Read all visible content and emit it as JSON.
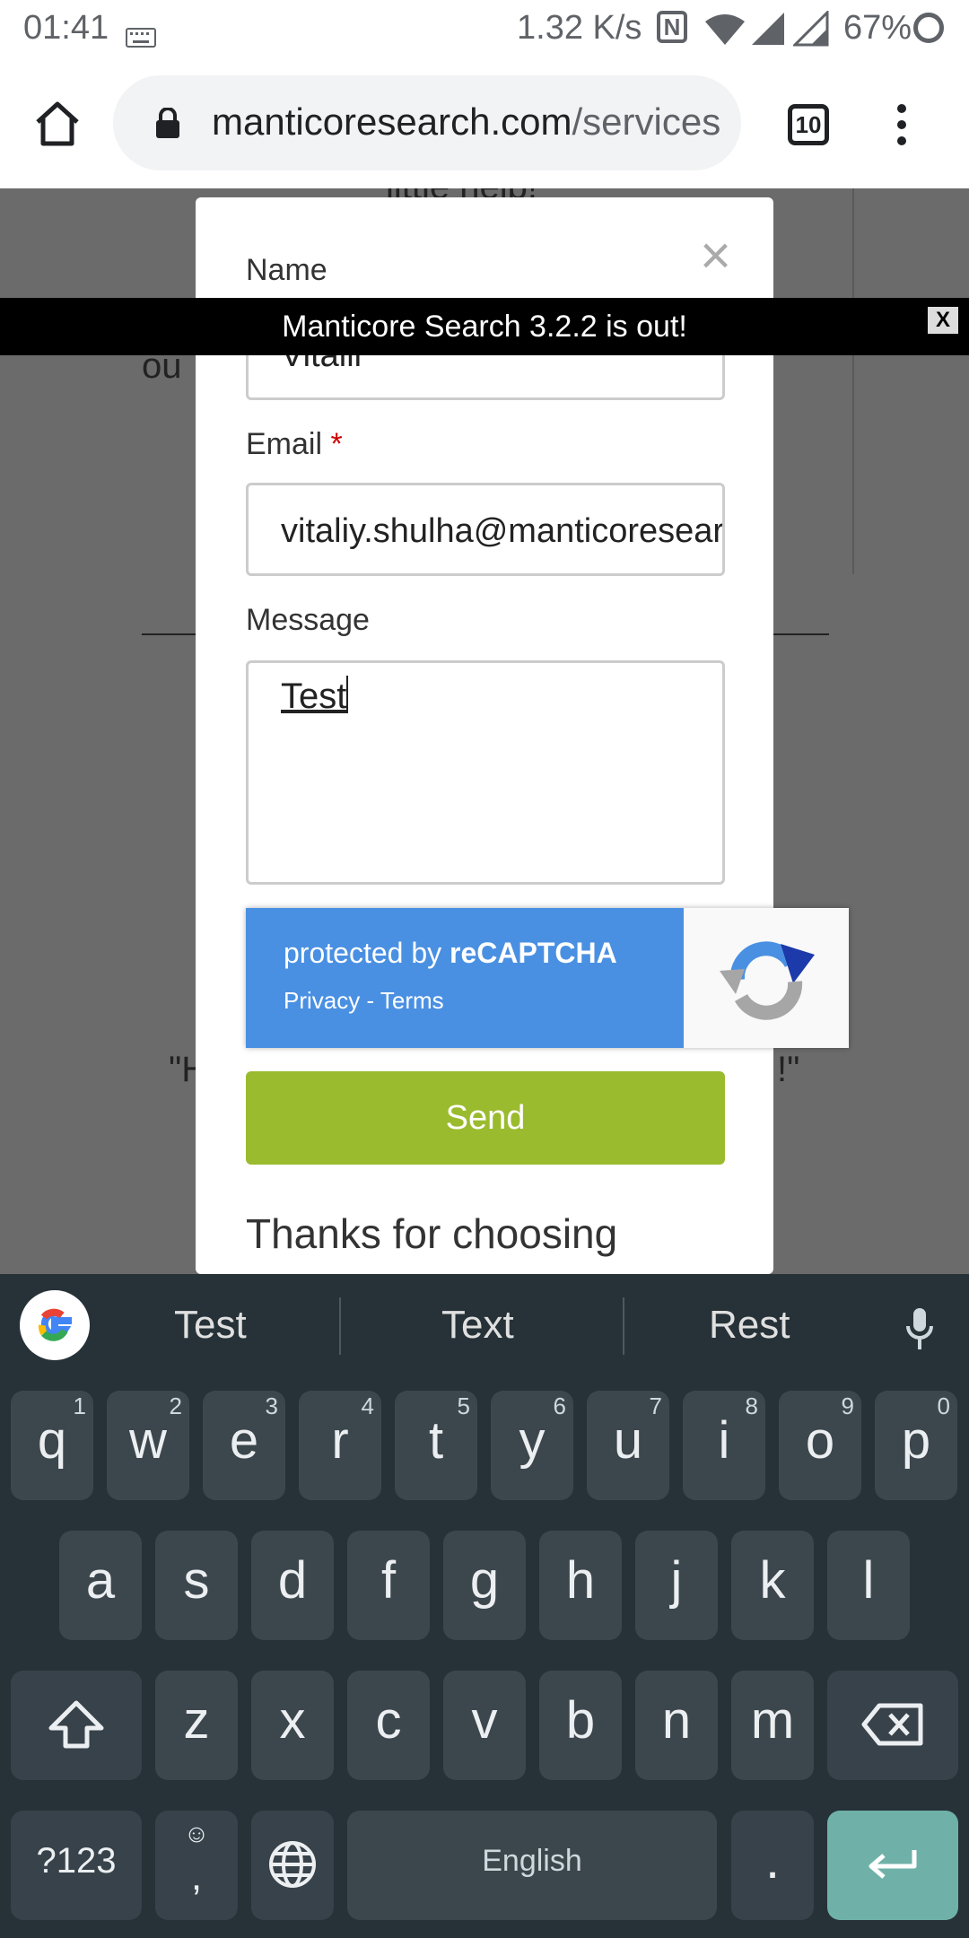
{
  "status": {
    "time": "01:41",
    "speed": "1.32 K/s",
    "battery": "67%"
  },
  "browser": {
    "url_main": "manticoresearch.com",
    "url_rest": "/services",
    "tab_count": "10"
  },
  "page": {
    "bg_text_top": "little help!\"",
    "bg_text_left": "ou",
    "bg_quote_left": "\"H",
    "bg_quote_right": "!\""
  },
  "announcement": {
    "text": "Manticore Search 3.2.2 is out!",
    "close_label": "X"
  },
  "form": {
    "close_icon": "×",
    "name_label": "Name",
    "name_value": "Vitalii",
    "email_label": "Email",
    "required_mark": "*",
    "email_value": "vitaliy.shulha@manticoresearch.com",
    "message_label": "Message",
    "message_value": "Test",
    "send_label": "Send",
    "thanks_text": "Thanks for choosing"
  },
  "recaptcha": {
    "protected_prefix": "protected by ",
    "brand": "reCAPTCHA",
    "links": "Privacy - Terms"
  },
  "keyboard": {
    "suggestions": [
      "Test",
      "Text",
      "Rest"
    ],
    "row1": [
      {
        "k": "q",
        "n": "1"
      },
      {
        "k": "w",
        "n": "2"
      },
      {
        "k": "e",
        "n": "3"
      },
      {
        "k": "r",
        "n": "4"
      },
      {
        "k": "t",
        "n": "5"
      },
      {
        "k": "y",
        "n": "6"
      },
      {
        "k": "u",
        "n": "7"
      },
      {
        "k": "i",
        "n": "8"
      },
      {
        "k": "o",
        "n": "9"
      },
      {
        "k": "p",
        "n": "0"
      }
    ],
    "row2": [
      "a",
      "s",
      "d",
      "f",
      "g",
      "h",
      "j",
      "k",
      "l"
    ],
    "row3": [
      "z",
      "x",
      "c",
      "v",
      "b",
      "n",
      "m"
    ],
    "symbols_label": "?123",
    "emoji_comma": ",",
    "space_label": "English",
    "period_label": "."
  }
}
